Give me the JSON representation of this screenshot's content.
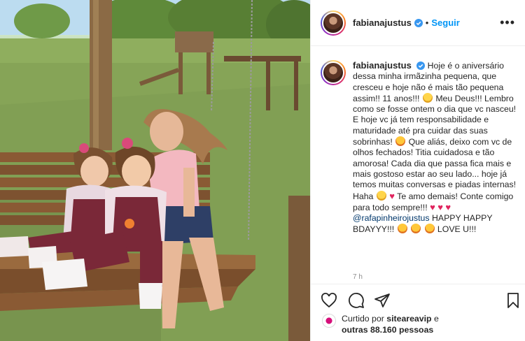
{
  "post": {
    "username": "fabianajustus",
    "follow_label": "Seguir",
    "more_label": "•••",
    "caption_parts": {
      "p1": "Hoje é o aniversário dessa minha irmãzinha pequena, que cresceu e hoje não é mais tão pequena assim!! 11 anos!!!",
      "p2": "Meu Deus!!! Lembro como se fosse ontem o dia que vc nasceu! E hoje vc já tem responsabilidade e maturidade até pra cuidar das suas sobrinhas!",
      "p3": "Que aliás, deixo com vc de olhos fechados! Titia cuidadosa e tão amorosa! Cada dia que passa fica mais e mais gostoso estar ao seu lado... hoje já temos muitas conversas e piadas internas! Haha",
      "p4": "Te amo demais! Conte comigo para todo sempre!!!",
      "mention": "@rafapinheirojustus",
      "p5": "HAPPY HAPPY BDAYYY!!!",
      "p6": "LOVE U!!!"
    },
    "time_ago": "7 h",
    "likes": {
      "prefix": "Curtido por",
      "liker": "siteareavip",
      "mid": "e",
      "others": "outras 88.160 pessoas"
    },
    "icons": {
      "like": "heart-outline-icon",
      "comment": "comment-bubble-icon",
      "share": "paper-plane-icon",
      "save": "bookmark-icon"
    }
  },
  "colors": {
    "link": "#0095f6",
    "mention": "#00376b",
    "text": "#262626",
    "muted": "#8e8e8e",
    "heart": "#e0245e"
  }
}
